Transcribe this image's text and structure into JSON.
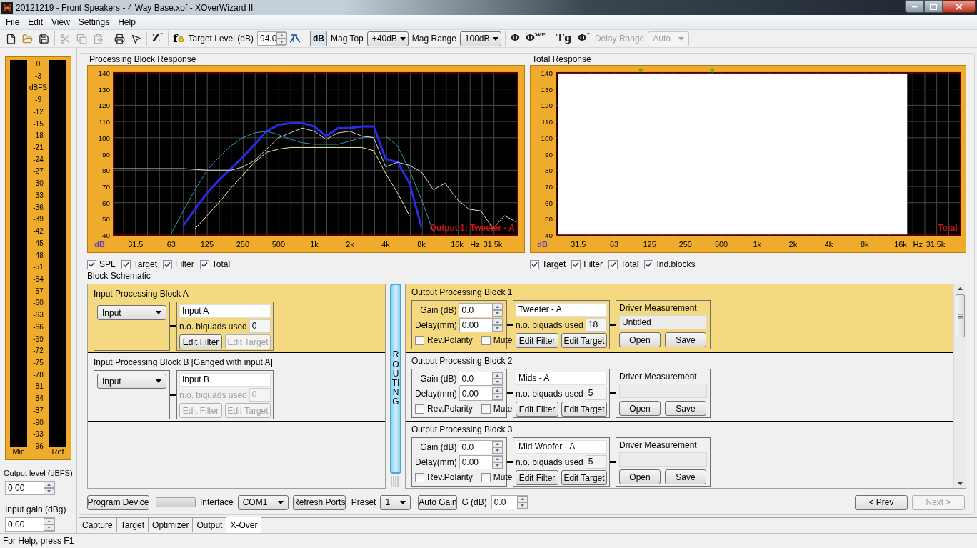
{
  "window": {
    "title": "20121219 - Front Speakers - 4 Way Base.xof - XOverWizard II"
  },
  "menu": [
    "File",
    "Edit",
    "View",
    "Settings",
    "Help"
  ],
  "toolbar": [
    {
      "kind": "new"
    },
    {
      "kind": "open"
    },
    {
      "kind": "save"
    },
    {
      "kind": "separator"
    },
    {
      "kind": "cut",
      "disabled": true
    },
    {
      "kind": "copy",
      "disabled": true
    },
    {
      "kind": "paste",
      "disabled": true
    },
    {
      "kind": "separator"
    },
    {
      "kind": "print"
    },
    {
      "kind": "help"
    },
    {
      "kind": "separator"
    },
    {
      "kind": "glyph",
      "text": "Z",
      "sup": "\""
    },
    {
      "kind": "separator"
    },
    {
      "kind": "lock_glyph",
      "text": "f"
    },
    {
      "kind": "label",
      "text": "Target Level (dB)",
      "disabled": false
    },
    {
      "kind": "spin",
      "value": "94.0"
    },
    {
      "kind": "curve"
    },
    {
      "kind": "separator"
    },
    {
      "kind": "toggle",
      "text": "dB",
      "pressed": true
    },
    {
      "kind": "label",
      "text": "Mag Top",
      "disabled": false
    },
    {
      "kind": "select",
      "value": "+40dB",
      "disabled": false
    },
    {
      "kind": "label",
      "text": "Mag Range",
      "disabled": false
    },
    {
      "kind": "select",
      "value": "100dB",
      "disabled": false
    },
    {
      "kind": "separator"
    },
    {
      "kind": "glyph",
      "text": "Φ"
    },
    {
      "kind": "glyph",
      "text": "Φ",
      "sup": "WP"
    },
    {
      "kind": "separator"
    },
    {
      "kind": "glyph",
      "text": "Tg"
    },
    {
      "kind": "glyph",
      "text": "Φ",
      "sup": "\""
    },
    {
      "kind": "label",
      "text": "Delay Range",
      "disabled": true
    },
    {
      "kind": "select",
      "value": "Auto",
      "disabled": true
    }
  ],
  "meter": {
    "scale": [
      "0",
      "-3",
      "dBFS",
      "-9",
      "-12",
      "-15",
      "-18",
      "-21",
      "-24",
      "-27",
      "-30",
      "-33",
      "-36",
      "-39",
      "-42",
      "-45",
      "-48",
      "-51",
      "-54",
      "-57",
      "-60",
      "-63",
      "-66",
      "-69",
      "-72",
      "-75",
      "-78",
      "-81",
      "-84",
      "-87",
      "-90",
      "-93",
      "-96"
    ],
    "channels": [
      "Mic",
      "Ref"
    ]
  },
  "output_level": {
    "label": "Output level (dBFS)",
    "value": "0.00"
  },
  "input_gain": {
    "label": "Input gain (dBg)",
    "value": "0.00"
  },
  "processing_block_response": {
    "title": "Processing Block Response",
    "chart_data": {
      "type": "line",
      "grid": true,
      "xlabel": "Hz",
      "ylabel": "dB",
      "ylim": [
        40,
        140
      ],
      "categories": [
        null,
        null,
        "31.5",
        null,
        null,
        "63",
        null,
        null,
        "125",
        null,
        null,
        "250",
        null,
        null,
        "500",
        null,
        null,
        "1k",
        null,
        null,
        "2k",
        null,
        null,
        "4k",
        null,
        null,
        "8k",
        null,
        null,
        "16k",
        null,
        null,
        "31.5k",
        null,
        null
      ],
      "series": [
        {
          "name": "SPL",
          "color": "#d8d8d8",
          "values": [
            81,
            81,
            81,
            81,
            81,
            81,
            81,
            80.5,
            80,
            80,
            80,
            82,
            86,
            93,
            100,
            103,
            106,
            104,
            99,
            103,
            104,
            101,
            100,
            82,
            85,
            83,
            79,
            68,
            72,
            62,
            56,
            55,
            44,
            52,
            48
          ]
        },
        {
          "name": "Target",
          "color": "#f0f0a0",
          "values": [
            null,
            null,
            null,
            null,
            null,
            null,
            null,
            44,
            52,
            60,
            69,
            77,
            85,
            91,
            93,
            94,
            94,
            94,
            94,
            94,
            94,
            94,
            92,
            78,
            66,
            52,
            null,
            null,
            null,
            null,
            null,
            null,
            null,
            null,
            null
          ]
        },
        {
          "name": "Filter",
          "color": "#2aa0b4",
          "values": [
            null,
            null,
            null,
            null,
            null,
            41,
            55,
            68,
            80,
            88,
            95,
            100,
            103,
            104,
            102,
            99,
            97,
            96,
            96,
            96,
            98,
            100,
            101,
            101,
            95,
            80,
            62,
            42,
            null,
            null,
            null,
            null,
            null,
            null,
            null
          ]
        },
        {
          "name": "Total",
          "color": "#2a2ae8",
          "values": [
            null,
            null,
            null,
            null,
            null,
            null,
            46,
            56,
            66,
            74,
            81,
            88,
            96,
            104,
            108,
            109,
            109,
            107,
            101,
            106,
            106,
            107,
            107,
            87,
            85,
            72,
            45,
            null,
            null,
            null,
            null,
            null,
            null,
            null,
            null
          ]
        }
      ],
      "yticks": [
        40,
        50,
        60,
        70,
        80,
        90,
        100,
        110,
        120,
        130,
        140
      ],
      "annotations": [
        {
          "text": "Output 1: Tweeter - A"
        }
      ]
    },
    "checkboxes": [
      {
        "checked": true
      },
      {
        "checked": true
      },
      {
        "checked": true
      },
      {
        "checked": true
      }
    ]
  },
  "total_response": {
    "title": "Total Response",
    "y_labels": [
      "140",
      "130",
      "120",
      "110",
      "100",
      "90",
      "80",
      "70",
      "60",
      "50",
      "40"
    ],
    "x_labels": [
      "31.5",
      "63",
      "125",
      "250",
      "500",
      "1k",
      "2k",
      "4k",
      "8k",
      "16k",
      "31.5k"
    ],
    "unit_y": "dB",
    "unit_x": "Hz",
    "corner_label": "Total",
    "checkboxes": [
      {
        "label": "Target",
        "checked": true
      },
      {
        "label": "Filter",
        "checked": true
      },
      {
        "label": "Total",
        "checked": true
      },
      {
        "label": "Ind.blocks",
        "checked": true
      }
    ]
  },
  "block_schematic": {
    "title": "Block Schematic",
    "routing": "ROUTING",
    "input_blocks": [
      {
        "title": "Input Processing Block A",
        "selected": true,
        "disabled": false,
        "source": "Input",
        "name": "Input A",
        "biquads_label": "n.o. biquads used",
        "biquads": "0",
        "edit_filter": "Edit Filter",
        "edit_target": "Edit Target",
        "edit_target_disabled": true
      },
      {
        "title": "Input Processing Block B [Ganged with input A]",
        "selected": false,
        "disabled": true,
        "source": "Input",
        "name": "Input B",
        "biquads_label": "n.o. biquads used",
        "biquads": "0",
        "edit_filter": "Edit Filter",
        "edit_target": "Edit Target",
        "edit_target_disabled": true
      }
    ],
    "output_blocks": [
      {
        "title": "Output Processing Block 1",
        "selected": true,
        "gain_label": "Gain (dB)",
        "gain": "0.0",
        "delay_label": "Delay(mm)",
        "delay": "0.00",
        "rev_polarity": {
          "label": "Rev.Polarity",
          "checked": false
        },
        "mute": {
          "label": "Mute",
          "checked": false
        },
        "name": "Tweeter - A",
        "biquads_label": "n.o. biquads used",
        "biquads": "18",
        "edit_filter": "Edit Filter",
        "edit_target": "Edit Target",
        "driver_label": "Driver Measurement",
        "driver_file": "Untitled",
        "open": "Open",
        "save": "Save"
      },
      {
        "title": "Output Processing Block 2",
        "selected": false,
        "gain_label": "Gain (dB)",
        "gain": "0.0",
        "delay_label": "Delay(mm)",
        "delay": "0.00",
        "rev_polarity": {
          "label": "Rev.Polarity",
          "checked": false
        },
        "mute": {
          "label": "Mute",
          "checked": false
        },
        "name": "Mids - A",
        "biquads_label": "n.o. biquads used",
        "biquads": "5",
        "edit_filter": "Edit Filter",
        "edit_target": "Edit Target",
        "driver_label": "Driver Measurement",
        "open": "Open",
        "save": "Save"
      },
      {
        "title": "Output Processing Block 3",
        "selected": false,
        "gain_label": "Gain (dB)",
        "gain": "0.0",
        "delay_label": "Delay(mm)",
        "delay": "0.00",
        "rev_polarity": {
          "label": "Rev.Polarity",
          "checked": false
        },
        "mute": {
          "label": "Mute",
          "checked": false
        },
        "name": "Mid Woofer - A",
        "biquads_label": "n.o. biquads used",
        "biquads": "5",
        "edit_filter": "Edit Filter",
        "edit_target": "Edit Target",
        "driver_label": "Driver Measurement",
        "open": "Open",
        "save": "Save"
      }
    ]
  },
  "bottom_bar": {
    "program_device": "Program Device",
    "progress": {
      "level": 0
    },
    "interface_label": "Interface",
    "interface": "COM1",
    "refresh_ports": "Refresh Ports",
    "preset_label": "Preset",
    "preset": "1",
    "auto_gain": "Auto Gain",
    "gain_label": "G (dB)",
    "gain": "0.0",
    "prev": "< Prev",
    "next": "Next >",
    "next_disabled": true,
    "prev_disabled": false
  },
  "tabs": [
    {
      "label": "Capture",
      "selected": false
    },
    {
      "label": "Target",
      "selected": false
    },
    {
      "label": "Optimizer",
      "selected": false
    },
    {
      "label": "Output",
      "selected": false
    },
    {
      "label": "X-Over",
      "selected": true
    }
  ],
  "status_bar": "For Help, press F1"
}
